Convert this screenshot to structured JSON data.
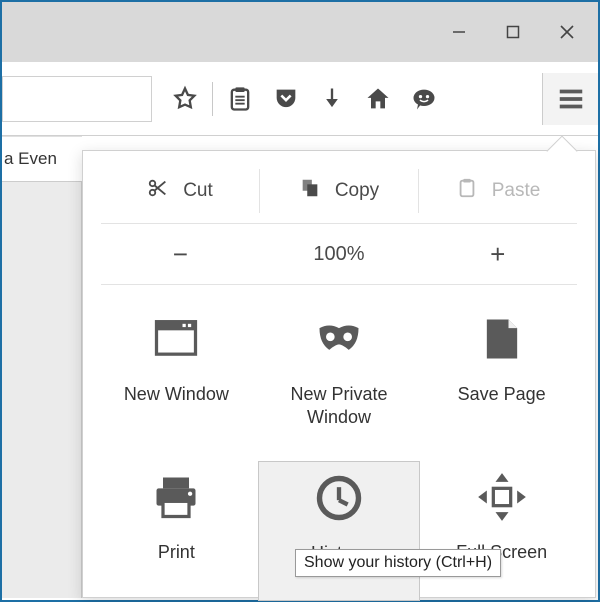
{
  "tab": {
    "label": "a Even"
  },
  "edit": {
    "cut": "Cut",
    "copy": "Copy",
    "paste": "Paste"
  },
  "zoom": {
    "minus": "−",
    "value": "100%",
    "plus": "+"
  },
  "grid": {
    "new_window": "New Window",
    "new_private": "New Private Window",
    "save_page": "Save Page",
    "print": "Print",
    "history": "History",
    "full_screen": "Full Screen"
  },
  "tooltip": {
    "history": "Show your history (Ctrl+H)"
  }
}
